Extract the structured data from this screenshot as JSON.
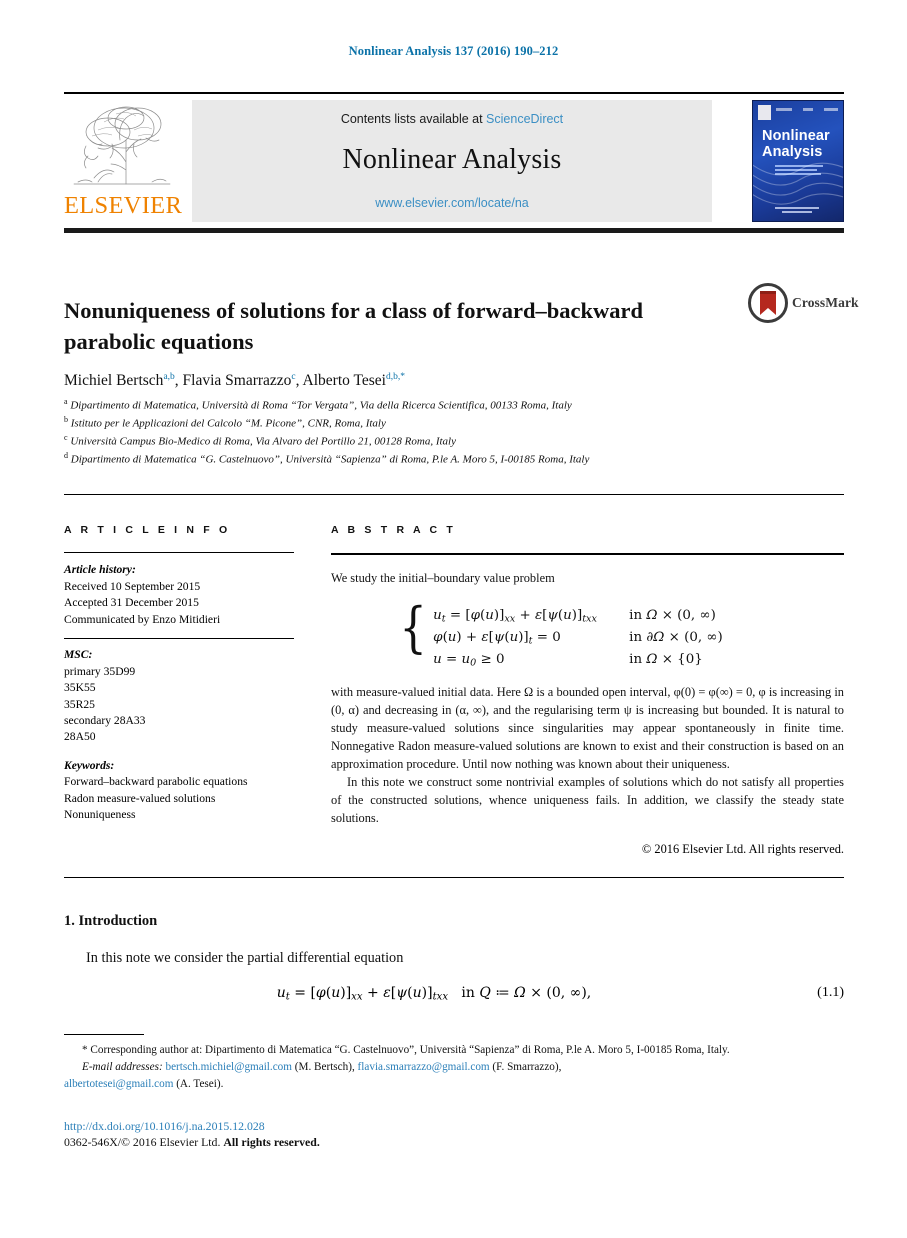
{
  "running_head": "Nonlinear Analysis 137 (2016) 190–212",
  "masthead": {
    "contents_prefix": "Contents lists available at ",
    "sciencedirect": "ScienceDirect",
    "journal_name": "Nonlinear Analysis",
    "journal_url": "www.elsevier.com/locate/na",
    "publisher_wordmark": "ELSEVIER",
    "cover_title_line1": "Nonlinear",
    "cover_title_line2": "Analysis"
  },
  "article": {
    "title": "Nonuniqueness of solutions for a class of forward–backward parabolic equations",
    "crossmark_label": "CrossMark",
    "authors_html": "Michiel Bertsch<sup>a,b</sup>, Flavia Smarrazzo<sup>c</sup>, Alberto Tesei<sup>d,b,*</sup>",
    "affiliations": [
      {
        "mark": "a",
        "text": "Dipartimento di Matematica, Università di Roma “Tor Vergata”, Via della Ricerca Scientifica, 00133 Roma, Italy"
      },
      {
        "mark": "b",
        "text": "Istituto per le Applicazioni del Calcolo “M. Picone”, CNR, Roma, Italy"
      },
      {
        "mark": "c",
        "text": "Università Campus Bio-Medico di Roma, Via Alvaro del Portillo 21, 00128 Roma, Italy"
      },
      {
        "mark": "d",
        "text": "Dipartimento di Matematica “G. Castelnuovo”, Università “Sapienza” di Roma, P.le A. Moro 5, I-00185 Roma, Italy"
      }
    ]
  },
  "article_info": {
    "heading": "A R T I C L E   I N F O",
    "history_label": "Article history:",
    "history": [
      "Received 10 September 2015",
      "Accepted 31 December 2015",
      "Communicated by Enzo Mitidieri"
    ],
    "msc_label": "MSC:",
    "msc": [
      "primary 35D99",
      "35K55",
      "35R25",
      "secondary 28A33",
      "28A50"
    ],
    "keywords_label": "Keywords:",
    "keywords": [
      "Forward–backward parabolic equations",
      "Radon measure-valued solutions",
      "Nonuniqueness"
    ]
  },
  "abstract": {
    "heading": "A B S T R A C T",
    "lead": "We study the initial–boundary value problem",
    "system": [
      {
        "lhs": "u_t = [φ(u)]_xx + ε[ψ(u)]_txx",
        "rhs": "in Ω × (0, ∞)"
      },
      {
        "lhs": "φ(u) + ε[ψ(u)]_t = 0",
        "rhs": "in ∂Ω × (0, ∞)"
      },
      {
        "lhs": "u = u_0 ≥ 0",
        "rhs": "in Ω × {0}"
      }
    ],
    "para1": "with measure-valued initial data. Here Ω is a bounded open interval, φ(0) = φ(∞) = 0, φ is increasing in (0, α) and decreasing in (α, ∞), and the regularising term ψ is increasing but bounded. It is natural to study measure-valued solutions since singularities may appear spontaneously in finite time. Nonnegative Radon measure-valued solutions are known to exist and their construction is based on an approximation procedure. Until now nothing was known about their uniqueness.",
    "para2": "In this note we construct some nontrivial examples of solutions which do not satisfy all properties of the constructed solutions, whence uniqueness fails. In addition, we classify the steady state solutions.",
    "copyright": "© 2016 Elsevier Ltd. All rights reserved."
  },
  "body": {
    "section_heading": "1. Introduction",
    "paragraph1": "In this note we consider the partial differential equation",
    "equation_1_1": "u_t = [φ(u)]_xx + ε[ψ(u)]_txx    in Q ≔ Ω × (0, ∞),",
    "equation_1_1_number": "(1.1)"
  },
  "footnotes": {
    "corresponding": "* Corresponding author at: Dipartimento di Matematica “G. Castelnuovo”, Università “Sapienza” di Roma, P.le A. Moro 5, I-00185 Roma, Italy.",
    "email_label": "E-mail addresses:",
    "emails": [
      {
        "address": "bertsch.michiel@gmail.com",
        "owner": "(M. Bertsch)"
      },
      {
        "address": "flavia.smarrazzo@gmail.com",
        "owner": "(F. Smarrazzo)"
      },
      {
        "address": "albertotesei@gmail.com",
        "owner": "(A. Tesei)"
      }
    ]
  },
  "footer": {
    "doi": "http://dx.doi.org/10.1016/j.na.2015.12.028",
    "issn_prefix": "0362-546X/",
    "issn_rest": "© 2016 Elsevier Ltd. ",
    "issn_bold": "All rights reserved."
  },
  "colors": {
    "link": "#2b7fb8",
    "running_head": "#0b72a8",
    "elsevier_orange": "#ef8200",
    "cover_blue": "#1f4bb0",
    "crossmark_red": "#b5281e"
  }
}
